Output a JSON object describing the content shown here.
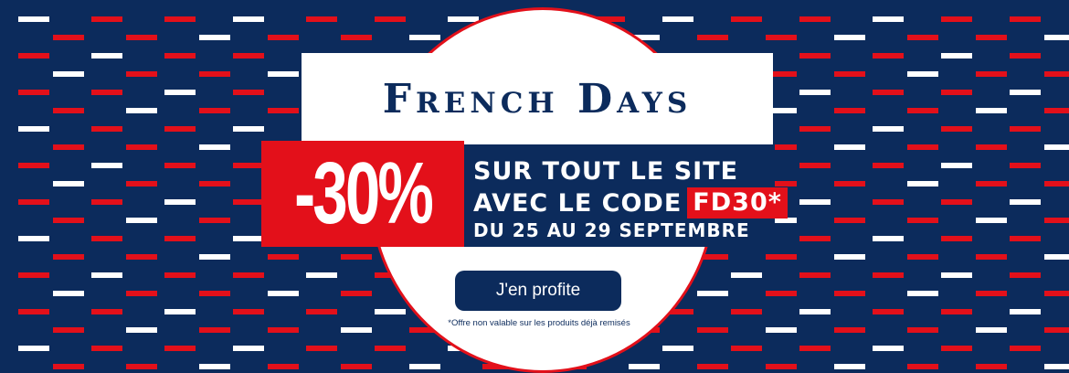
{
  "banner": {
    "title": "French Days",
    "discount": "-30%",
    "line1": "SUR TOUT LE SITE",
    "line2_prefix": "AVEC LE CODE",
    "promo_code": "FD30*",
    "dates": "DU 25 AU 29 SEPTEMBRE",
    "cta_label": "J'en profite",
    "disclaimer": "*Offre non valable sur les produits déjà remisés"
  },
  "colors": {
    "navy": "#0c2b5c",
    "red": "#e3101a",
    "white": "#ffffff"
  }
}
